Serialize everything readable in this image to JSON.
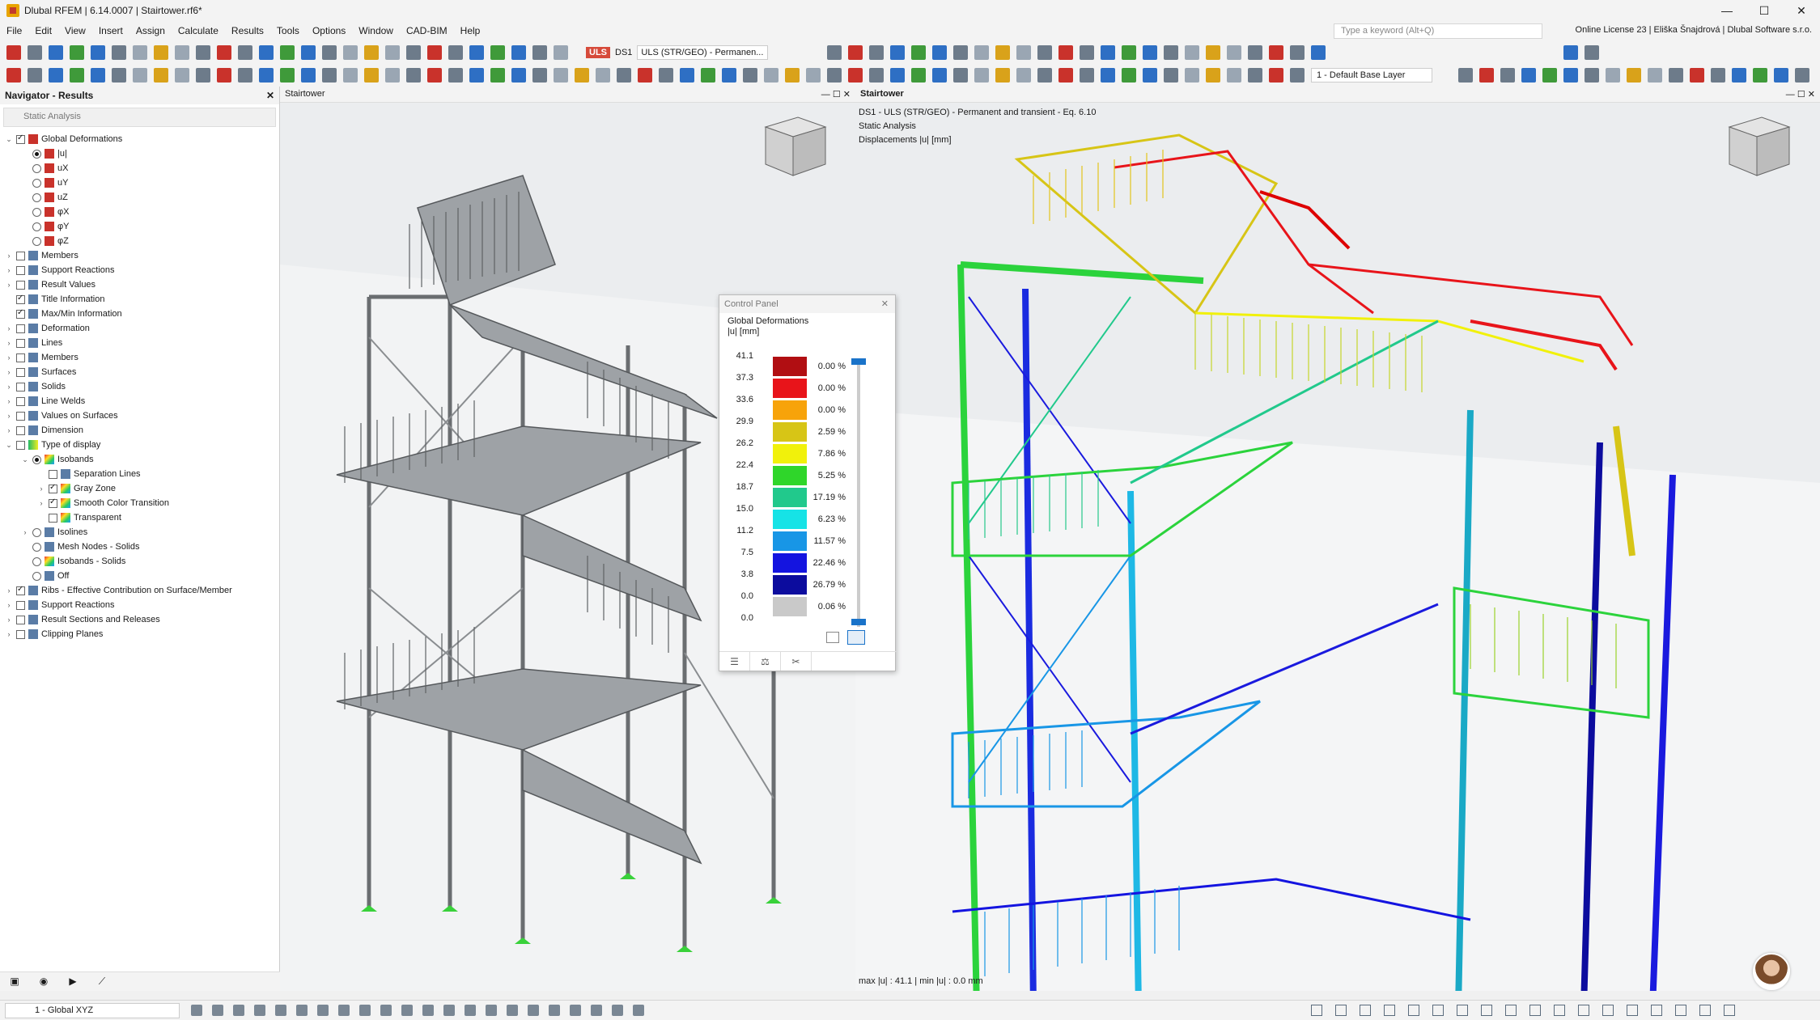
{
  "window": {
    "title": "Dlubal RFEM | 6.14.0007 | Stairtower.rf6*",
    "min": "—",
    "max": "☐",
    "close": "✕"
  },
  "menu": [
    "File",
    "Edit",
    "View",
    "Insert",
    "Assign",
    "Calculate",
    "Results",
    "Tools",
    "Options",
    "Window",
    "CAD-BIM",
    "Help"
  ],
  "search": {
    "placeholder": "Type a keyword (Alt+Q)"
  },
  "license": "Online License 23 | Eliška Šnajdrová | Dlubal Software s.r.o.",
  "loadcase": {
    "tag": "ULS",
    "ds": "DS1",
    "combo": "ULS (STR/GEO) - Permanen..."
  },
  "layer": "1 - Default Base Layer",
  "navigator": {
    "title": "Navigator - Results",
    "subtitle": "Static Analysis",
    "items": [
      {
        "label": "Global Deformations",
        "level": 0,
        "ctrl": "cb",
        "on": true,
        "exp": "v",
        "icon": "deform-icon"
      },
      {
        "label": "|u|",
        "level": 1,
        "ctrl": "rd",
        "on": true,
        "icon": "deform-icon"
      },
      {
        "label": "uX",
        "level": 1,
        "ctrl": "rd",
        "on": false,
        "icon": "deform-icon"
      },
      {
        "label": "uY",
        "level": 1,
        "ctrl": "rd",
        "on": false,
        "icon": "deform-icon"
      },
      {
        "label": "uZ",
        "level": 1,
        "ctrl": "rd",
        "on": false,
        "icon": "deform-icon"
      },
      {
        "label": "φX",
        "level": 1,
        "ctrl": "rd",
        "on": false,
        "icon": "deform-icon"
      },
      {
        "label": "φY",
        "level": 1,
        "ctrl": "rd",
        "on": false,
        "icon": "deform-icon"
      },
      {
        "label": "φZ",
        "level": 1,
        "ctrl": "rd",
        "on": false,
        "icon": "deform-icon"
      },
      {
        "label": "Members",
        "level": 0,
        "ctrl": "cb",
        "on": false,
        "exp": ">",
        "icon": "members-icon"
      },
      {
        "label": "Support Reactions",
        "level": 0,
        "ctrl": "cb",
        "on": false,
        "exp": ">",
        "icon": "support-icon"
      },
      {
        "label": "Result Values",
        "level": 0,
        "ctrl": "cb",
        "on": false,
        "exp": ">",
        "icon": "values-icon"
      },
      {
        "label": "Title Information",
        "level": 0,
        "ctrl": "cb",
        "on": true,
        "exp": "",
        "icon": "title-icon"
      },
      {
        "label": "Max/Min Information",
        "level": 0,
        "ctrl": "cb",
        "on": true,
        "exp": "",
        "icon": "maxmin-icon"
      },
      {
        "label": "Deformation",
        "level": 0,
        "ctrl": "cb",
        "on": false,
        "exp": ">",
        "icon": "deformation-icon"
      },
      {
        "label": "Lines",
        "level": 0,
        "ctrl": "cb",
        "on": false,
        "exp": ">",
        "icon": "lines-icon"
      },
      {
        "label": "Members",
        "level": 0,
        "ctrl": "cb",
        "on": false,
        "exp": ">",
        "icon": "members-icon"
      },
      {
        "label": "Surfaces",
        "level": 0,
        "ctrl": "cb",
        "on": false,
        "exp": ">",
        "icon": "surfaces-icon"
      },
      {
        "label": "Solids",
        "level": 0,
        "ctrl": "cb",
        "on": false,
        "exp": ">",
        "icon": "solids-icon"
      },
      {
        "label": "Line Welds",
        "level": 0,
        "ctrl": "cb",
        "on": false,
        "exp": ">",
        "icon": "welds-icon"
      },
      {
        "label": "Values on Surfaces",
        "level": 0,
        "ctrl": "cb",
        "on": false,
        "exp": ">",
        "icon": "values-icon"
      },
      {
        "label": "Dimension",
        "level": 0,
        "ctrl": "cb",
        "on": false,
        "exp": ">",
        "icon": "dimension-icon"
      },
      {
        "label": "Type of display",
        "level": 0,
        "ctrl": "cb",
        "on": false,
        "exp": "v",
        "icon": "display-icon"
      },
      {
        "label": "Isobands",
        "level": 1,
        "ctrl": "rd",
        "on": true,
        "exp": "v",
        "icon": "isobands-icon"
      },
      {
        "label": "Separation Lines",
        "level": 2,
        "ctrl": "cb",
        "on": false,
        "icon": "lines-icon"
      },
      {
        "label": "Gray Zone",
        "level": 2,
        "ctrl": "cb",
        "on": true,
        "exp": ">",
        "icon": "isobands-icon"
      },
      {
        "label": "Smooth Color Transition",
        "level": 2,
        "ctrl": "cb",
        "on": true,
        "exp": ">",
        "icon": "isobands-icon"
      },
      {
        "label": "Transparent",
        "level": 2,
        "ctrl": "cb",
        "on": false,
        "icon": "isobands-icon"
      },
      {
        "label": "Isolines",
        "level": 1,
        "ctrl": "rd",
        "on": false,
        "exp": ">",
        "icon": "isolines-icon"
      },
      {
        "label": "Mesh Nodes - Solids",
        "level": 1,
        "ctrl": "rd",
        "on": false,
        "icon": "mesh-icon"
      },
      {
        "label": "Isobands - Solids",
        "level": 1,
        "ctrl": "rd",
        "on": false,
        "icon": "isobands-icon"
      },
      {
        "label": "Off",
        "level": 1,
        "ctrl": "rd",
        "on": false,
        "icon": "off-icon"
      },
      {
        "label": "Ribs - Effective Contribution on Surface/Member",
        "level": 0,
        "ctrl": "cb",
        "on": true,
        "exp": ">",
        "icon": "ribs-icon"
      },
      {
        "label": "Support Reactions",
        "level": 0,
        "ctrl": "cb",
        "on": false,
        "exp": ">",
        "icon": "support-icon"
      },
      {
        "label": "Result Sections and Releases",
        "level": 0,
        "ctrl": "cb",
        "on": false,
        "exp": ">",
        "icon": "sections-icon"
      },
      {
        "label": "Clipping Planes",
        "level": 0,
        "ctrl": "cb",
        "on": false,
        "exp": ">",
        "icon": "clipping-icon"
      }
    ]
  },
  "view_left": {
    "title": "Stairtower"
  },
  "view_right": {
    "title": "Stairtower",
    "info": [
      "DS1 - ULS (STR/GEO) - Permanent and transient - Eq. 6.10",
      "Static Analysis",
      "Displacements |u| [mm]"
    ],
    "maxmin": "max |u| : 41.1 | min |u| : 0.0 mm"
  },
  "control_panel": {
    "title": "Control Panel",
    "heading": "Global Deformations",
    "unit": "|u| [mm]",
    "legend": [
      {
        "value": "41.1",
        "color": "#b10e12",
        "pct": "0.00 %"
      },
      {
        "value": "37.3",
        "color": "#e8141a",
        "pct": "0.00 %"
      },
      {
        "value": "33.6",
        "color": "#f7a30a",
        "pct": "0.00 %"
      },
      {
        "value": "29.9",
        "color": "#d7c516",
        "pct": "2.59 %"
      },
      {
        "value": "26.2",
        "color": "#f1f10b",
        "pct": "7.86 %"
      },
      {
        "value": "22.4",
        "color": "#2fd62a",
        "pct": "5.25 %"
      },
      {
        "value": "18.7",
        "color": "#21c98c",
        "pct": "17.19 %"
      },
      {
        "value": "15.0",
        "color": "#16e3e6",
        "pct": "6.23 %"
      },
      {
        "value": "11.2",
        "color": "#1896e6",
        "pct": "11.57 %"
      },
      {
        "value": "7.5",
        "color": "#1414e0",
        "pct": "22.46 %"
      },
      {
        "value": "3.8",
        "color": "#0c0c9e",
        "pct": "26.79 %"
      },
      {
        "value": "0.0",
        "color": "#c9c9c9",
        "pct": "0.06 %"
      }
    ],
    "bottom_value": "0.0",
    "tabs": [
      "☰",
      "⚖",
      "✂"
    ]
  },
  "status": {
    "coordsys": "1 - Global XYZ"
  },
  "nav_tabs": [
    "▣",
    "◉",
    "▶",
    "⟋"
  ]
}
